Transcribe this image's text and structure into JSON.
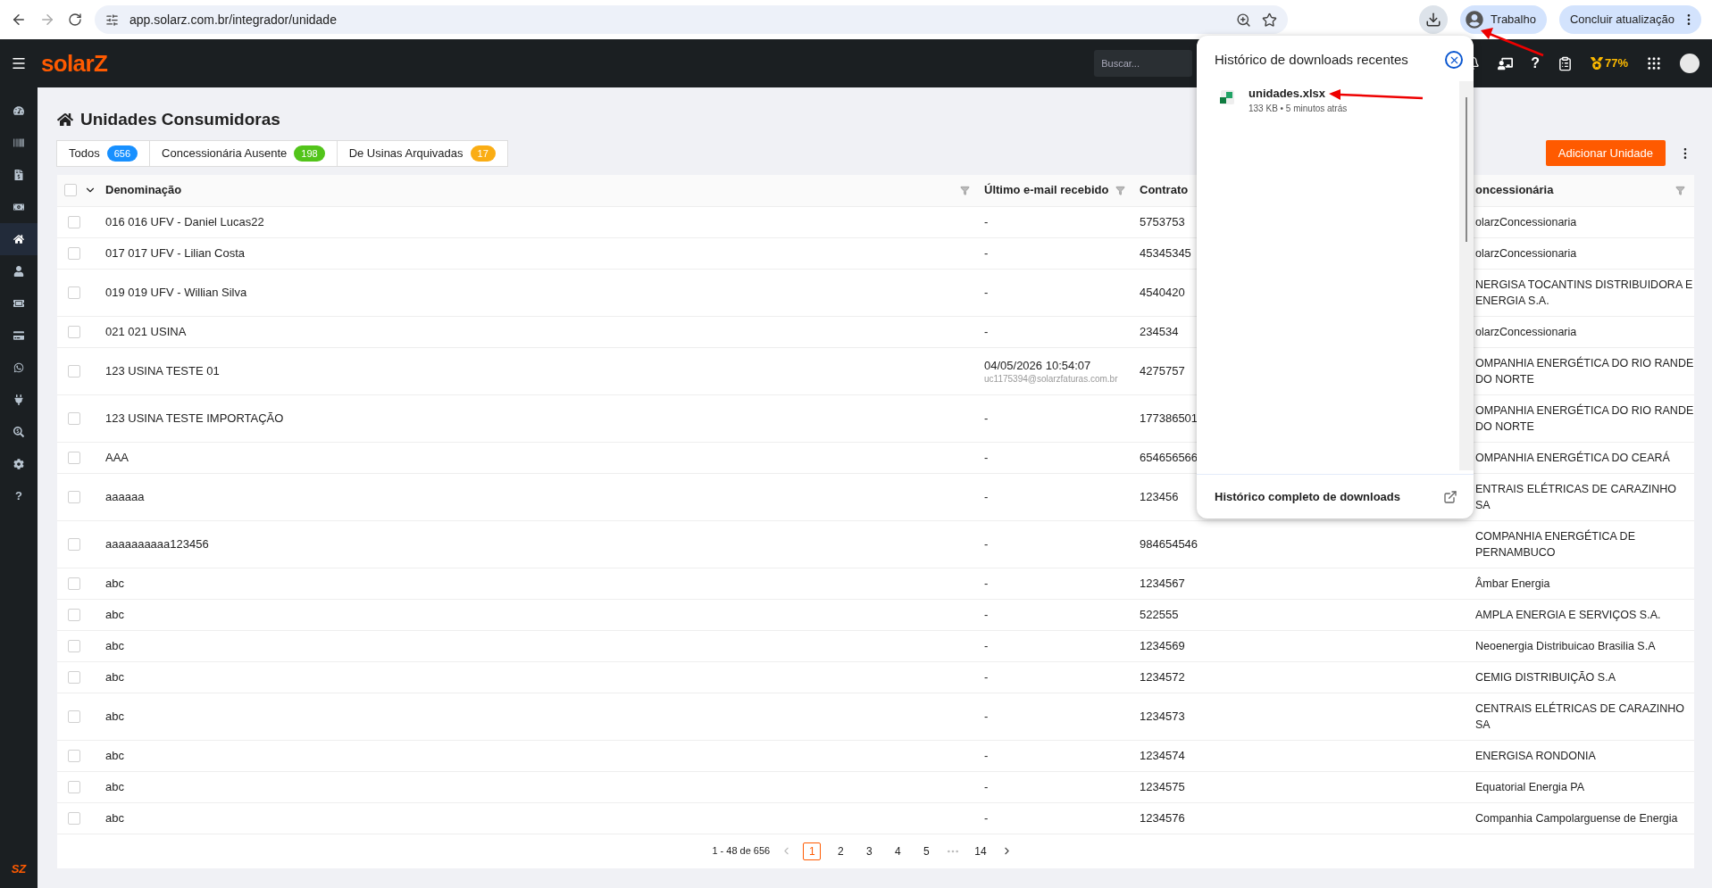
{
  "browser": {
    "url": "app.solarz.com.br/integrador/unidade",
    "profile": "Trabalho",
    "update_button": "Concluir atualização"
  },
  "header": {
    "logo": "solarZ",
    "search": {
      "placeholder": "Buscar..."
    },
    "help": "?",
    "score": "77%"
  },
  "sidebar": {
    "items": [
      {
        "kind": "icon",
        "selected": false
      },
      {
        "kind": "icon",
        "selected": false
      },
      {
        "kind": "icon",
        "selected": false
      },
      {
        "kind": "icon",
        "selected": false
      },
      {
        "kind": "icon",
        "selected": true
      },
      {
        "kind": "icon",
        "selected": false
      },
      {
        "kind": "icon",
        "selected": false
      },
      {
        "kind": "icon",
        "selected": false
      },
      {
        "kind": "icon",
        "selected": false
      },
      {
        "kind": "icon",
        "selected": false
      },
      {
        "kind": "icon",
        "selected": false
      },
      {
        "kind": "icon",
        "selected": false
      },
      {
        "kind": "text",
        "label": "?",
        "selected": false
      }
    ],
    "footer_logo": "SZ"
  },
  "page": {
    "title": "Unidades Consumidoras",
    "tabs": [
      {
        "label": "Todos",
        "count": "656",
        "color": "#1890ff"
      },
      {
        "label": "Concessionária Ausente",
        "count": "198",
        "color": "#52c41a"
      },
      {
        "label": "De Usinas Arquivadas",
        "count": "17",
        "color": "#faad14"
      }
    ],
    "add_button": "Adicionar Unidade"
  },
  "table": {
    "select_all": {
      "checked": false
    },
    "columns": [
      "Denominação",
      "Último e-mail recebido",
      "Contrato",
      "oncessionária"
    ],
    "rows": [
      {
        "checked": false,
        "name": "016 016 UFV - Daniel Lucas22",
        "email": "-",
        "contract": "5753753",
        "utility": "olarzConcessionaria"
      },
      {
        "checked": false,
        "name": "017 017 UFV - Lilian Costa",
        "email": "-",
        "contract": "45345345",
        "utility": "olarzConcessionaria"
      },
      {
        "checked": false,
        "name": "019 019 UFV - Willian Silva",
        "email": "-",
        "contract": "4540420",
        "utility": "NERGISA TOCANTINS DISTRIBUIDORA E ENERGIA S.A."
      },
      {
        "checked": false,
        "name": "021 021 USINA",
        "email": "-",
        "contract": "234534",
        "utility": "olarzConcessionaria"
      },
      {
        "checked": false,
        "name": "123 USINA TESTE 01",
        "email": "04/05/2026 10:54:07",
        "email_address": "uc1175394@solarzfaturas.com.br",
        "contract": "4275757",
        "utility": "OMPANHIA ENERGÉTICA DO RIO RANDE DO NORTE"
      },
      {
        "checked": false,
        "name": "123 USINA TESTE IMPORTAÇÃO",
        "email": "-",
        "contract": "177386501",
        "utility": "OMPANHIA ENERGÉTICA DO RIO RANDE DO NORTE"
      },
      {
        "checked": false,
        "name": "AAA",
        "email": "-",
        "contract": "654656566",
        "utility": "OMPANHIA ENERGÉTICA DO CEARÁ"
      },
      {
        "checked": false,
        "name": "aaaaaa",
        "email": "-",
        "contract": "123456",
        "utility": "ENTRAIS ELÉTRICAS DE CARAZINHO SA"
      },
      {
        "checked": false,
        "name": "aaaaaaaaaa123456",
        "email": "-",
        "contract": "984654546",
        "utility": "COMPANHIA ENERGÉTICA DE PERNAMBUCO"
      },
      {
        "checked": false,
        "name": "abc",
        "email": "-",
        "contract": "1234567",
        "utility": "Âmbar Energia"
      },
      {
        "checked": false,
        "name": "abc",
        "email": "-",
        "contract": "522555",
        "utility": "AMPLA ENERGIA E SERVIÇOS S.A."
      },
      {
        "checked": false,
        "name": "abc",
        "email": "-",
        "contract": "1234569",
        "utility": "Neoenergia Distribuicao Brasilia S.A"
      },
      {
        "checked": false,
        "name": "abc",
        "email": "-",
        "contract": "1234572",
        "utility": "CEMIG DISTRIBUIÇÃO S.A"
      },
      {
        "checked": false,
        "name": "abc",
        "email": "-",
        "contract": "1234573",
        "utility": "CENTRAIS ELÉTRICAS DE CARAZINHO SA"
      },
      {
        "checked": false,
        "name": "abc",
        "email": "-",
        "contract": "1234574",
        "utility": "ENERGISA RONDONIA"
      },
      {
        "checked": false,
        "name": "abc",
        "email": "-",
        "contract": "1234575",
        "utility": "Equatorial Energia PA"
      },
      {
        "checked": false,
        "name": "abc",
        "email": "-",
        "contract": "1234576",
        "utility": "Companhia Campolarguense de Energia"
      }
    ]
  },
  "pagination": {
    "range": "1 - 48 de 656",
    "pages": [
      {
        "kind": "page",
        "label": "1",
        "selected": true
      },
      {
        "kind": "page",
        "label": "2",
        "selected": false
      },
      {
        "kind": "page",
        "label": "3",
        "selected": false
      },
      {
        "kind": "page",
        "label": "4",
        "selected": false
      },
      {
        "kind": "page",
        "label": "5",
        "selected": false
      },
      {
        "kind": "ellipsis"
      },
      {
        "kind": "page",
        "label": "14",
        "selected": false
      }
    ]
  },
  "downloads": {
    "title": "Histórico de downloads recentes",
    "items": [
      {
        "filename": "unidades.xlsx",
        "meta": "133 KB • 5 minutos atrás"
      }
    ],
    "footer": "Histórico completo de downloads"
  }
}
